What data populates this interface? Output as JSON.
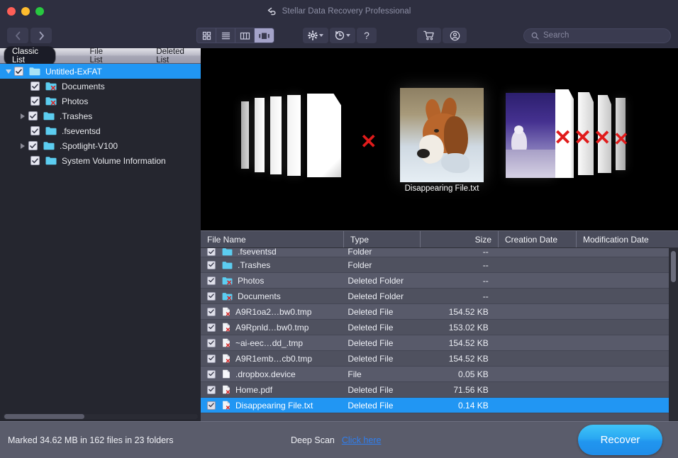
{
  "window": {
    "title": "Stellar Data Recovery Professional",
    "back_icon": "back-arrow-icon",
    "traffic_lights": [
      "close",
      "minimize",
      "maximize"
    ]
  },
  "toolbar": {
    "nav": {
      "back": "chevron-left-icon",
      "forward": "chevron-right-icon"
    },
    "view_modes": [
      {
        "name": "icon-view",
        "icon": "grid-icon",
        "active": false
      },
      {
        "name": "list-view",
        "icon": "lines-icon",
        "active": false
      },
      {
        "name": "column-view",
        "icon": "columns-icon",
        "active": false
      },
      {
        "name": "coverflow-view",
        "icon": "coverflow-icon",
        "active": true
      }
    ],
    "buttons": [
      {
        "name": "settings",
        "icon": "gear-icon",
        "has_dropdown": true
      },
      {
        "name": "history",
        "icon": "clock-revert-icon",
        "has_dropdown": true
      },
      {
        "name": "help",
        "icon": "question-mark-icon",
        "has_dropdown": false
      },
      {
        "name": "store",
        "icon": "shopping-cart-icon",
        "has_dropdown": false
      },
      {
        "name": "account",
        "icon": "user-circle-icon",
        "has_dropdown": false
      }
    ],
    "search": {
      "placeholder": "Search",
      "value": "",
      "icon": "search-icon"
    }
  },
  "sidebar": {
    "tabs": [
      {
        "label": "Classic List",
        "active": true
      },
      {
        "label": "File List",
        "active": false
      },
      {
        "label": "Deleted List",
        "active": false
      }
    ],
    "tree": [
      {
        "label": "Untitled-ExFAT",
        "level": 0,
        "checked": true,
        "selected": true,
        "expander": "open",
        "icon": "folder-icon"
      },
      {
        "label": "Documents",
        "level": 1,
        "checked": true,
        "selected": false,
        "expander": "none",
        "icon": "deleted-folder-icon"
      },
      {
        "label": "Photos",
        "level": 1,
        "checked": true,
        "selected": false,
        "expander": "none",
        "icon": "deleted-folder-icon"
      },
      {
        "label": ".Trashes",
        "level": 1,
        "checked": true,
        "selected": false,
        "expander": "collapsed",
        "icon": "folder-icon"
      },
      {
        "label": ".fseventsd",
        "level": 1,
        "checked": true,
        "selected": false,
        "expander": "none",
        "icon": "folder-icon"
      },
      {
        "label": ".Spotlight-V100",
        "level": 1,
        "checked": true,
        "selected": false,
        "expander": "collapsed",
        "icon": "folder-icon"
      },
      {
        "label": "System Volume Information",
        "level": 1,
        "checked": true,
        "selected": false,
        "expander": "none",
        "icon": "folder-icon"
      }
    ]
  },
  "preview": {
    "selected_file_label": "Disappearing File.txt",
    "background_color": "#000000",
    "center_image": "fox-photo",
    "right_image": "polar-bear-photo"
  },
  "table": {
    "columns": [
      "File Name",
      "Type",
      "Size",
      "Creation Date",
      "Modification Date"
    ],
    "rows": [
      {
        "name": ".fseventsd",
        "type": "Folder",
        "size": "--",
        "creation": "",
        "modification": "",
        "checked": true,
        "icon": "folder-icon",
        "selected": false,
        "clipped": true
      },
      {
        "name": ".Trashes",
        "type": "Folder",
        "size": "--",
        "creation": "",
        "modification": "",
        "checked": true,
        "icon": "folder-icon",
        "selected": false
      },
      {
        "name": "Photos",
        "type": "Deleted Folder",
        "size": "--",
        "creation": "",
        "modification": "",
        "checked": true,
        "icon": "deleted-folder-icon",
        "selected": false
      },
      {
        "name": "Documents",
        "type": "Deleted Folder",
        "size": "--",
        "creation": "",
        "modification": "",
        "checked": true,
        "icon": "deleted-folder-icon",
        "selected": false
      },
      {
        "name": "A9R1oa2…bw0.tmp",
        "type": "Deleted File",
        "size": "154.52 KB",
        "creation": "",
        "modification": "",
        "checked": true,
        "icon": "deleted-file-icon",
        "selected": false
      },
      {
        "name": "A9Rpnld…bw0.tmp",
        "type": "Deleted File",
        "size": "153.02 KB",
        "creation": "",
        "modification": "",
        "checked": true,
        "icon": "deleted-file-icon",
        "selected": false
      },
      {
        "name": "~ai-eec…dd_.tmp",
        "type": "Deleted File",
        "size": "154.52 KB",
        "creation": "",
        "modification": "",
        "checked": true,
        "icon": "deleted-file-icon",
        "selected": false
      },
      {
        "name": "A9R1emb…cb0.tmp",
        "type": "Deleted File",
        "size": "154.52 KB",
        "creation": "",
        "modification": "",
        "checked": true,
        "icon": "deleted-file-icon",
        "selected": false
      },
      {
        "name": ".dropbox.device",
        "type": "File",
        "size": "0.05 KB",
        "creation": "",
        "modification": "",
        "checked": true,
        "icon": "file-icon",
        "selected": false
      },
      {
        "name": "Home.pdf",
        "type": "Deleted File",
        "size": "71.56 KB",
        "creation": "",
        "modification": "",
        "checked": true,
        "icon": "deleted-file-icon",
        "selected": false
      },
      {
        "name": "Disappearing File.txt",
        "type": "Deleted File",
        "size": "0.14 KB",
        "creation": "",
        "modification": "",
        "checked": true,
        "icon": "deleted-file-icon",
        "selected": true
      }
    ]
  },
  "footer": {
    "status": "Marked 34.62 MB in 162 files in 23 folders",
    "deep_scan_label": "Deep Scan",
    "deep_scan_link": "Click here",
    "recover_button": "Recover"
  },
  "colors": {
    "accent_blue": "#2196f3",
    "window_chrome": "#2e2f40",
    "sidebar_bg": "#25262f",
    "table_bg": "#4e505f",
    "footer_bg": "#5a5c6b",
    "link_blue": "#2f7ff0",
    "folder_cyan": "#5ccdf0",
    "delete_red": "#e01b1b"
  }
}
